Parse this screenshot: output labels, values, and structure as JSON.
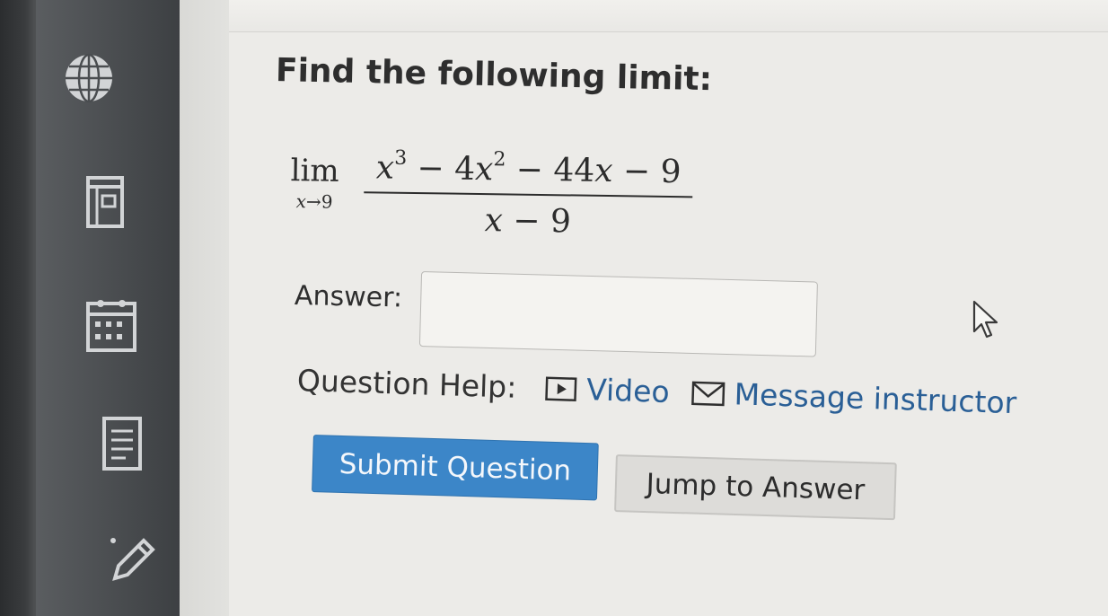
{
  "sidebar": {
    "items": [
      {
        "icon": "globe-icon"
      },
      {
        "icon": "gradebook-icon"
      },
      {
        "icon": "calendar-icon"
      },
      {
        "icon": "notes-icon"
      },
      {
        "icon": "edit-pencil-icon"
      }
    ]
  },
  "question": {
    "prompt": "Find the following limit:",
    "limit": {
      "lim_word": "lim",
      "sub_var": "x",
      "sub_arrow": "→",
      "sub_value": "9",
      "numerator": {
        "t1_var": "x",
        "t1_exp": "3",
        "op1": " − ",
        "t2_coef": "4",
        "t2_var": "x",
        "t2_exp": "2",
        "op2": " − ",
        "t3_coef": "44",
        "t3_var": "x",
        "op3": " − ",
        "t4": "9"
      },
      "denominator": {
        "var": "x",
        "op": " − ",
        "value": "9"
      }
    },
    "answer_label": "Answer:",
    "answer_value": "",
    "answer_placeholder": ""
  },
  "help": {
    "label": "Question Help:",
    "video_label": "Video",
    "message_label": "Message instructor"
  },
  "buttons": {
    "submit_label": "Submit Question",
    "jump_label": "Jump to Answer"
  },
  "colors": {
    "link": "#2a5f96",
    "submit_bg": "#3c86c8",
    "sidebar_bg": "#4a4d50"
  }
}
